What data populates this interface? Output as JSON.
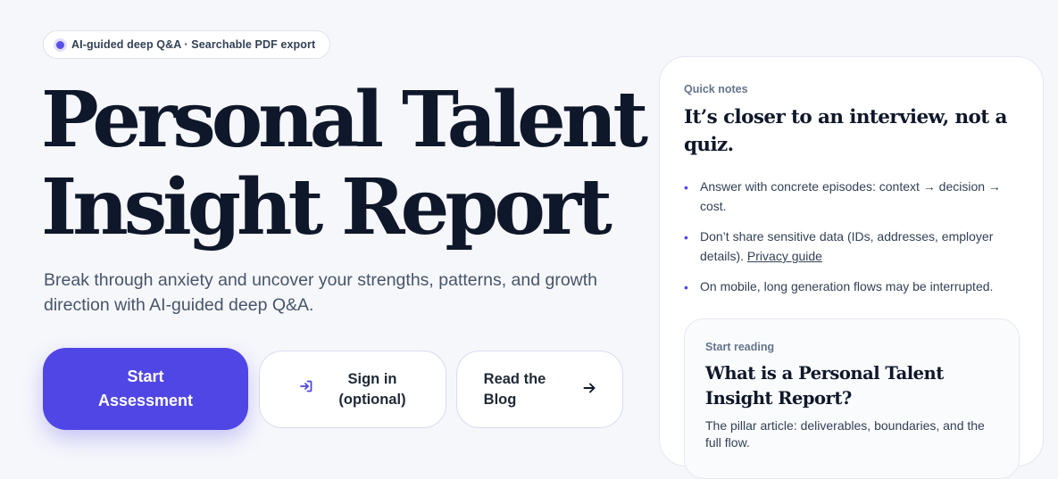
{
  "badge": {
    "text": "AI-guided deep Q&A · Searchable PDF export",
    "dot_color": "#5b4fe8"
  },
  "hero": {
    "title_line1": "Personal Talent",
    "title_line2": "Insight Report",
    "subtitle": "Break through anxiety and uncover your strengths, patterns, and growth direction with AI-guided deep Q&A."
  },
  "actions": {
    "start_line1": "Start",
    "start_line2": "Assessment",
    "signin_icon": "sign-in-icon",
    "signin_line1": "Sign in",
    "signin_line2": "(optional)",
    "blog_line1": "Read the",
    "blog_line2": "Blog",
    "blog_icon": "arrow-right-icon"
  },
  "notes_card": {
    "eyebrow": "Quick notes",
    "title": "It’s closer to an interview, not a quiz.",
    "items": [
      {
        "text": "Answer with concrete episodes: context → decision → cost."
      },
      {
        "text": "Don’t share sensitive data (IDs, addresses, employer details).",
        "link": "Privacy guide"
      },
      {
        "text": "On mobile, long generation flows may be interrupted."
      }
    ]
  },
  "reading_card": {
    "eyebrow": "Start reading",
    "title": "What is a Personal Talent Insight Report?",
    "text": "The pillar article: deliverables, boundaries, and the full flow."
  },
  "colors": {
    "accent": "#5046e5",
    "background": "#f6f7fb",
    "heading": "#0f172a"
  }
}
